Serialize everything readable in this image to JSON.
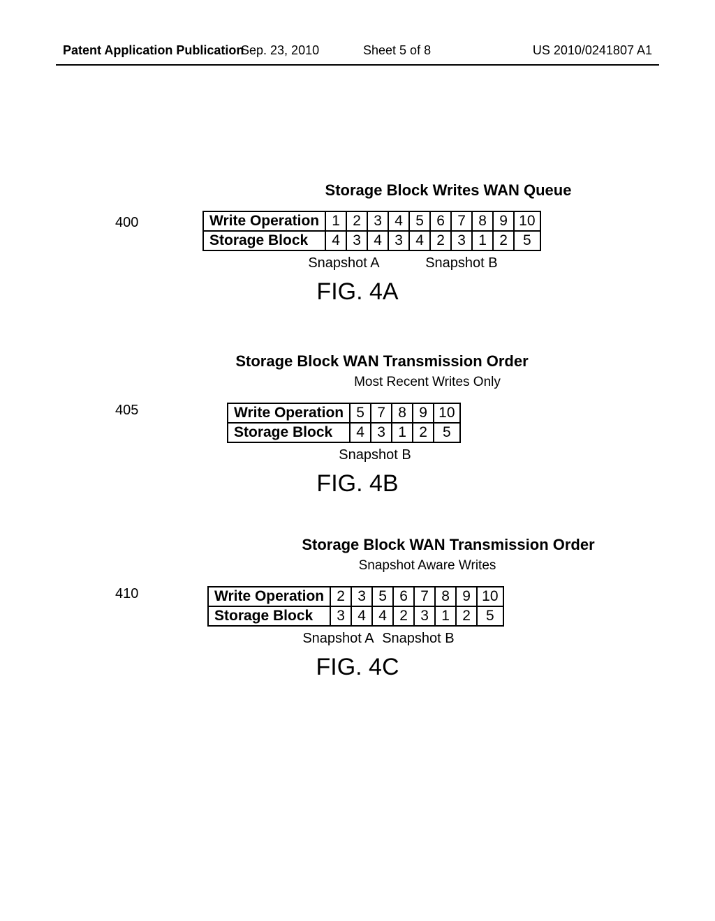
{
  "header": {
    "pub": "Patent Application Publication",
    "date": "Sep. 23, 2010",
    "sheet": "Sheet 5 of 8",
    "patno": "US 2010/0241807 A1"
  },
  "figA": {
    "ref": "400",
    "title": "Storage Block Writes WAN Queue",
    "rowlabels": {
      "wo": "Write Operation",
      "sb": "Storage Block"
    },
    "wo": [
      "1",
      "2",
      "3",
      "4",
      "5",
      "6",
      "7",
      "8",
      "9",
      "10"
    ],
    "sb": [
      "4",
      "3",
      "4",
      "3",
      "4",
      "2",
      "3",
      "1",
      "2",
      "5"
    ],
    "snapA": "Snapshot A",
    "snapB": "Snapshot B",
    "caption": "FIG. 4A"
  },
  "figB": {
    "ref": "405",
    "title": "Storage Block WAN Transmission Order",
    "subtitle": "Most Recent Writes Only",
    "rowlabels": {
      "wo": "Write Operation",
      "sb": "Storage Block"
    },
    "wo": [
      "5",
      "7",
      "8",
      "9",
      "10"
    ],
    "sb": [
      "4",
      "3",
      "1",
      "2",
      "5"
    ],
    "snapB": "Snapshot B",
    "caption": "FIG. 4B"
  },
  "figC": {
    "ref": "410",
    "title": "Storage Block WAN Transmission Order",
    "subtitle": "Snapshot Aware Writes",
    "rowlabels": {
      "wo": "Write Operation",
      "sb": "Storage Block"
    },
    "wo": [
      "2",
      "3",
      "5",
      "6",
      "7",
      "8",
      "9",
      "10"
    ],
    "sb": [
      "3",
      "4",
      "4",
      "2",
      "3",
      "1",
      "2",
      "5"
    ],
    "snapA": "Snapshot A",
    "snapB": "Snapshot B",
    "caption": "FIG. 4C"
  },
  "chart_data": [
    {
      "type": "table",
      "id": "FIG.4A",
      "title": "Storage Block Writes WAN Queue",
      "series": [
        {
          "name": "Write Operation",
          "values": [
            1,
            2,
            3,
            4,
            5,
            6,
            7,
            8,
            9,
            10
          ]
        },
        {
          "name": "Storage Block",
          "values": [
            4,
            3,
            4,
            3,
            4,
            2,
            3,
            1,
            2,
            5
          ]
        }
      ],
      "snapshot_markers": {
        "Snapshot A": 3,
        "Snapshot B": 7
      }
    },
    {
      "type": "table",
      "id": "FIG.4B",
      "title": "Storage Block WAN Transmission Order – Most Recent Writes Only",
      "series": [
        {
          "name": "Write Operation",
          "values": [
            5,
            7,
            8,
            9,
            10
          ]
        },
        {
          "name": "Storage Block",
          "values": [
            4,
            3,
            1,
            2,
            5
          ]
        }
      ],
      "snapshot_markers": {
        "Snapshot B": 2
      }
    },
    {
      "type": "table",
      "id": "FIG.4C",
      "title": "Storage Block WAN Transmission Order – Snapshot Aware Writes",
      "series": [
        {
          "name": "Write Operation",
          "values": [
            2,
            3,
            5,
            6,
            7,
            8,
            9,
            10
          ]
        },
        {
          "name": "Storage Block",
          "values": [
            3,
            4,
            4,
            2,
            3,
            1,
            2,
            5
          ]
        }
      ],
      "snapshot_markers": {
        "Snapshot A": 2,
        "Snapshot B": 5
      }
    }
  ]
}
